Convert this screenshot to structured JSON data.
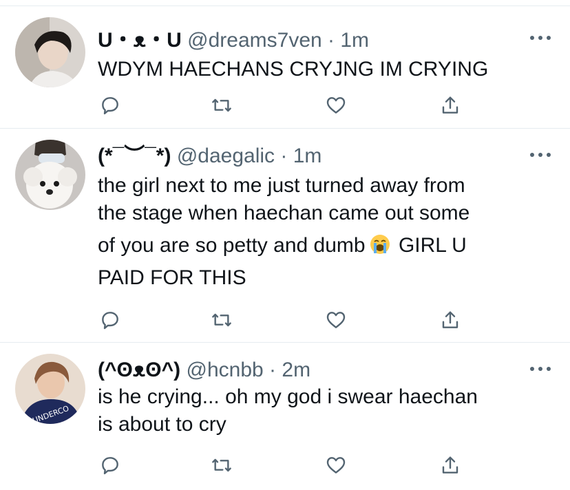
{
  "tweets": [
    {
      "display_name": "U・ᴥ・U",
      "handle": "@dreams7ven",
      "time": "1m",
      "lines": [
        "WDYM HAECHANS CRYJNG IM CRYING"
      ],
      "avatar": "avatar-boy-dark-hair"
    },
    {
      "display_name": "(*¯︶¯*)",
      "handle": "@daegalic",
      "time": "1m",
      "lines": [
        "the girl next to me just turned away from",
        "the stage when haechan came out some",
        "of you are so petty and dumb",
        "GIRL U",
        "PAID FOR THIS"
      ],
      "emoji": "loudly-crying-face-emoji",
      "avatar": "avatar-white-puppy"
    },
    {
      "display_name": "(^ʘᴥʘ^)",
      "handle": "@hcnbb",
      "time": "2m",
      "lines": [
        "is he crying... oh my god i swear haechan",
        "is about to cry"
      ],
      "avatar": "avatar-boy-navy-hoodie"
    }
  ],
  "separator": "·",
  "icons": {
    "reply": "reply-icon",
    "retweet": "retweet-icon",
    "like": "heart-icon",
    "share": "share-icon",
    "more": "more-icon"
  },
  "colors": {
    "text": "#0f1419",
    "secondary": "#536471",
    "divider": "#e6ecf0"
  }
}
